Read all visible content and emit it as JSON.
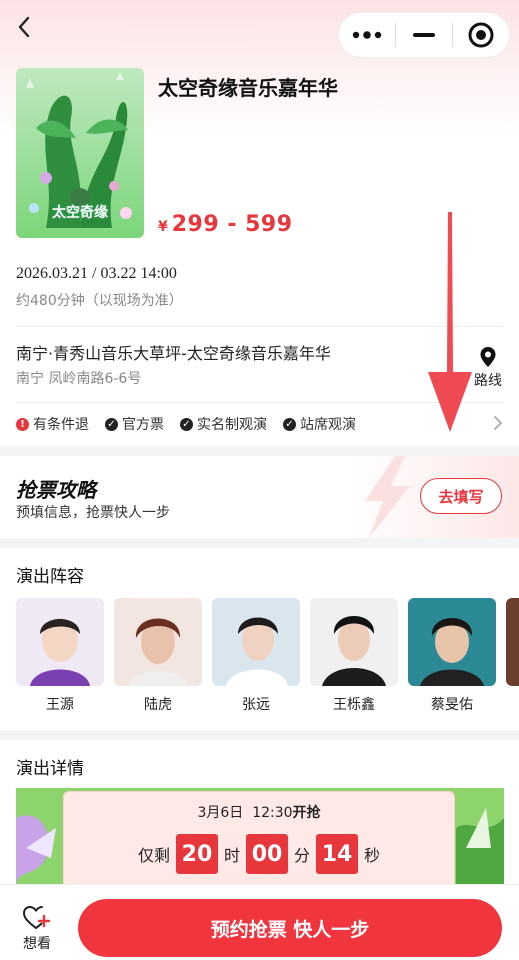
{
  "event": {
    "title": "太空奇缘音乐嘉年华",
    "price_symbol": "¥",
    "price_range": "299 - 599",
    "poster_caption": "太空奇缘",
    "datetime": "2026.03.21 / 03.22 14:00",
    "duration": "约480分钟（以现场为准）",
    "venue": "南宁·青秀山音乐大草坪-太空奇缘音乐嘉年华",
    "address": "南宁 凤岭南路6-6号",
    "route_label": "路线"
  },
  "tags": [
    {
      "label": "有条件退",
      "icon": "alert-icon",
      "color": "#e8363d"
    },
    {
      "label": "官方票",
      "icon": "check-icon",
      "color": "#222222"
    },
    {
      "label": "实名制观演",
      "icon": "check-icon",
      "color": "#222222"
    },
    {
      "label": "站席观演",
      "icon": "check-icon",
      "color": "#222222"
    }
  ],
  "strategy": {
    "title": "抢票攻略",
    "subtitle": "预填信息，抢票快人一步",
    "button": "去填写"
  },
  "lineup": {
    "title": "演出阵容",
    "artists": [
      {
        "name": "王源",
        "bg": "#efe8f5"
      },
      {
        "name": "陆虎",
        "bg": "#f3e6e0"
      },
      {
        "name": "张远",
        "bg": "#d9e6ee"
      },
      {
        "name": "王栎鑫",
        "bg": "#f0f0f0"
      },
      {
        "name": "蔡旻佑",
        "bg": "#2b8a95"
      }
    ]
  },
  "details": {
    "title": "演出详情",
    "countdown_date": "3月6日",
    "countdown_time": "12:30",
    "countdown_suffix": "开抢",
    "remain_label": "仅剩",
    "hours": "20",
    "hours_unit": "时",
    "minutes": "00",
    "minutes_unit": "分",
    "seconds": "14",
    "seconds_unit": "秒"
  },
  "bottom": {
    "want_label": "想看",
    "buy_label": "预约抢票 快人一步"
  },
  "colors": {
    "accent": "#e8363d",
    "button": "#f0353f"
  }
}
